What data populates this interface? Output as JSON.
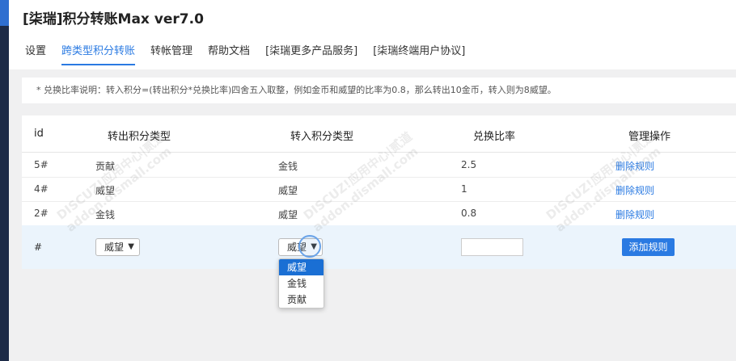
{
  "app": {
    "title": "[柒瑞]积分转账Max ver7.0"
  },
  "tabs": [
    {
      "label": "设置",
      "active": false
    },
    {
      "label": "跨类型积分转账",
      "active": true
    },
    {
      "label": "转帐管理",
      "active": false
    },
    {
      "label": "帮助文档",
      "active": false
    },
    {
      "label": "[柒瑞更多产品服务]",
      "active": false
    },
    {
      "label": "[柒瑞终端用户协议]",
      "active": false
    }
  ],
  "notice": "* 兑换比率说明：转入积分=(转出积分*兑换比率)四舍五入取整，例如金币和威望的比率为0.8，那么转出10金币，转入则为8威望。",
  "table": {
    "headers": {
      "id": "id",
      "from": "转出积分类型",
      "to": "转入积分类型",
      "ratio": "兑换比率",
      "action": "管理操作"
    },
    "rows": [
      {
        "id": "5#",
        "from": "贡献",
        "to": "金钱",
        "ratio": "2.5",
        "action": "删除规则"
      },
      {
        "id": "4#",
        "from": "威望",
        "to": "威望",
        "ratio": "1",
        "action": "删除规则"
      },
      {
        "id": "2#",
        "from": "金钱",
        "to": "威望",
        "ratio": "0.8",
        "action": "删除规则"
      }
    ],
    "add_row": {
      "id": "#",
      "from_selected": "威望",
      "to_selected": "威望",
      "ratio_value": "",
      "add_button": "添加规则"
    }
  },
  "dropdown": {
    "options": [
      "威望",
      "金钱",
      "贡献"
    ],
    "highlighted_index": 0
  },
  "watermark": {
    "line1": "DISCUZ!应用中心|贰道",
    "line2": "addon.dismall.com"
  },
  "colors": {
    "accent": "#2a7ae2",
    "sidebar": "#1d2b47",
    "highlight": "#1a6fd4"
  }
}
